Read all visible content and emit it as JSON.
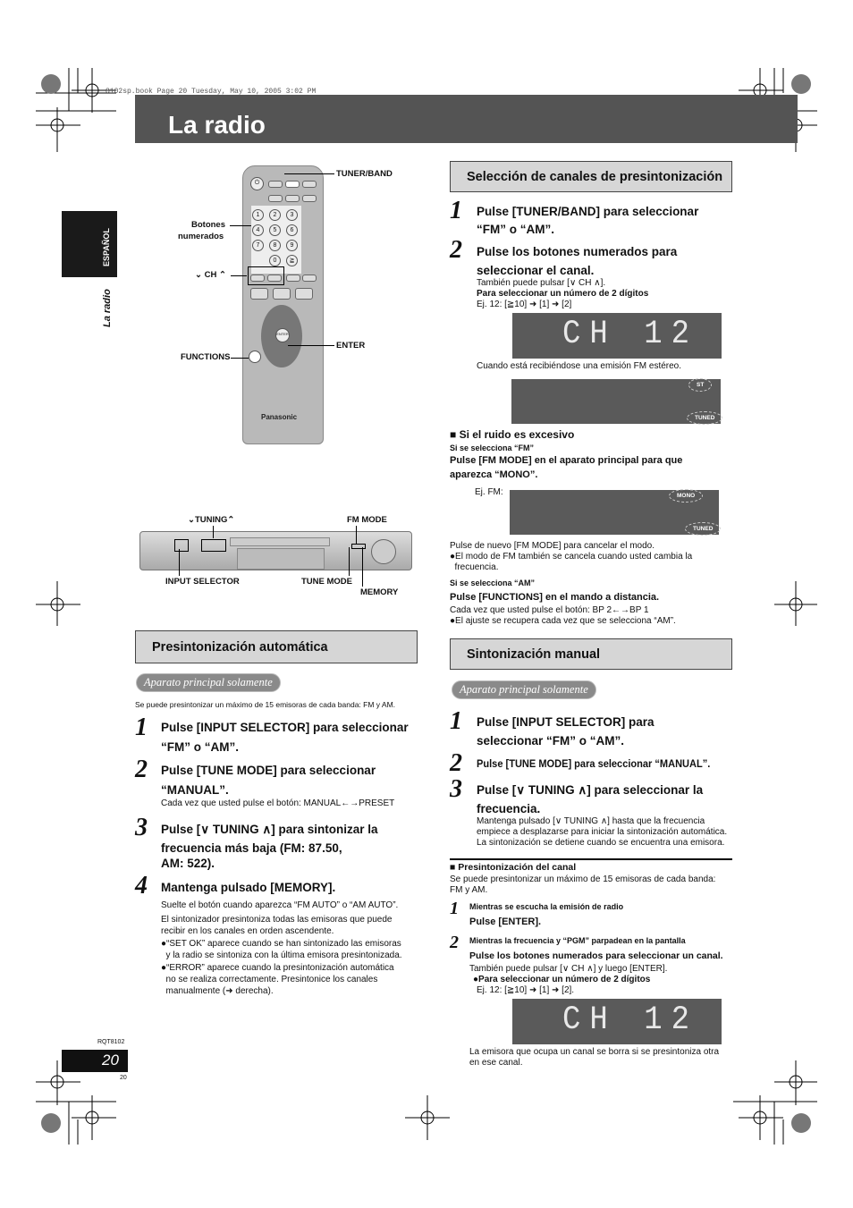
{
  "header": {
    "file_line": "8102sp.book  Page 20  Tuesday, May 10, 2005  3:02 PM",
    "title": "La radio"
  },
  "side": {
    "language_tab": "ESPAÑOL",
    "section": "La radio"
  },
  "remote_labels": {
    "tuner_band": "TUNER/BAND",
    "numbered_buttons_1": "Botones",
    "numbered_buttons_2": "numerados",
    "ch": "⌄ CH ⌃",
    "functions": "FUNCTIONS",
    "enter": "ENTER",
    "brand": "Panasonic"
  },
  "unit_labels": {
    "tuning": "⌄TUNING⌃",
    "fm_mode": "FM MODE",
    "input_selector": "INPUT SELECTOR",
    "tune_mode": "TUNE MODE",
    "memory": "MEMORY"
  },
  "auto_preset": {
    "heading": "Presintonización automática",
    "badge": "Aparato principal solamente",
    "intro": "Se puede presintonizar un máximo de 15 emisoras de cada banda: FM y AM.",
    "steps": [
      {
        "n": "1",
        "l1": "Pulse [INPUT SELECTOR] para seleccionar",
        "l2": "“FM” o “AM”."
      },
      {
        "n": "2",
        "l1": "Pulse [TUNE MODE] para seleccionar",
        "l2": "“MANUAL”.",
        "note": "Cada vez que usted pulse el botón: MANUAL←→PRESET"
      },
      {
        "n": "3",
        "l1": "Pulse [∨ TUNING ∧] para sintonizar la",
        "l2": "frecuencia más baja (FM:   87.50,",
        "l3": "AM:  522)."
      },
      {
        "n": "4",
        "l1": "Mantenga pulsado [MEMORY]."
      }
    ],
    "notes": [
      "Suelte el botón cuando aparezca “FM AUTO” o “AM AUTO”.",
      "El sintonizador presintoniza todas las emisoras que puede",
      "recibir en los canales en orden ascendente.",
      "●“SET OK” aparece cuando se han sintonizado las emisoras",
      "  y la radio se sintoniza con la última emisora presintonizada.",
      "●“ERROR” aparece cuando la presintonización automática",
      "  no se realiza correctamente. Presintonice los canales",
      "  manualmente (➜ derecha)."
    ]
  },
  "channel_select": {
    "heading": "Selección de canales de presintonización",
    "steps": [
      {
        "n": "1",
        "l1": "Pulse [TUNER/BAND] para seleccionar",
        "l2": "“FM” o “AM”."
      },
      {
        "n": "2",
        "l1": "Pulse los botones numerados para",
        "l2": "seleccionar el canal."
      }
    ],
    "also": "También puede pulsar [∨ CH ∧].",
    "two_digit": "Para seleccionar un número de 2 dígitos",
    "example": "Ej. 12: [≧10] ➜ [1] ➜ [2]",
    "display_ch": "CH  12",
    "stereo_note": "Cuando está recibiéndose una emisión FM estéreo.",
    "ind_st": "ST",
    "ind_tuned": "TUNED",
    "noise_heading": "■ Si el ruido es excesivo",
    "fm_sel": "Si se selecciona “FM”",
    "fm_instr_1": "Pulse [FM MODE] en el aparato principal para que",
    "fm_instr_2": "aparezca “MONO”.",
    "ej_fm": "Ej. FM:",
    "ind_mono": "MONO",
    "cancel_1": "Pulse de nuevo [FM MODE] para cancelar el modo.",
    "cancel_2": "●El modo de FM también se cancela cuando usted cambia la",
    "cancel_3": "  frecuencia.",
    "am_sel": "Si se selecciona “AM”",
    "am_instr": "Pulse [FUNCTIONS] en el mando a distancia.",
    "am_note_1": "Cada vez que usted pulse el botón: BP 2←→BP 1",
    "am_note_2": "●El ajuste se recupera cada vez que se selecciona “AM”."
  },
  "manual": {
    "heading": "Sintonización manual",
    "badge": "Aparato principal solamente",
    "steps": [
      {
        "n": "1",
        "l1": "Pulse [INPUT SELECTOR] para",
        "l2": "seleccionar “FM” o “AM”."
      },
      {
        "n": "2",
        "l1": "Pulse [TUNE MODE] para seleccionar “MANUAL”."
      },
      {
        "n": "3",
        "l1": "Pulse [∨ TUNING ∧] para seleccionar la",
        "l2": "frecuencia."
      }
    ],
    "notes": [
      "Mantenga pulsado [∨ TUNING ∧] hasta que la frecuencia",
      "empiece a desplazarse para iniciar la sintonización automática.",
      "La sintonización se detiene cuando se encuentra una emisora."
    ],
    "preset_heading": "■ Presintonización del canal",
    "preset_intro_1": "Se puede presintonizar un máximo de 15 emisoras de cada banda:",
    "preset_intro_2": "FM y AM.",
    "p1_cond": "Mientras se escucha la emisión de radio",
    "p1_instr": "Pulse [ENTER].",
    "p2_cond": "Mientras la frecuencia y “PGM” parpadean en la pantalla",
    "p2_instr": "Pulse los botones numerados para seleccionar un canal.",
    "p2_also": "También puede pulsar [∨ CH ∧] y luego [ENTER].",
    "p2_two": "●Para seleccionar un número de 2 dígitos",
    "p2_ex": "Ej. 12: [≧10] ➜ [1] ➜ [2].",
    "display_ch": "CH  12",
    "final_1": "La emisora que ocupa un canal se borra si se presintoniza otra",
    "final_2": "en ese canal."
  },
  "footer": {
    "code": "RQT8102",
    "page": "20",
    "page_small": "20"
  }
}
